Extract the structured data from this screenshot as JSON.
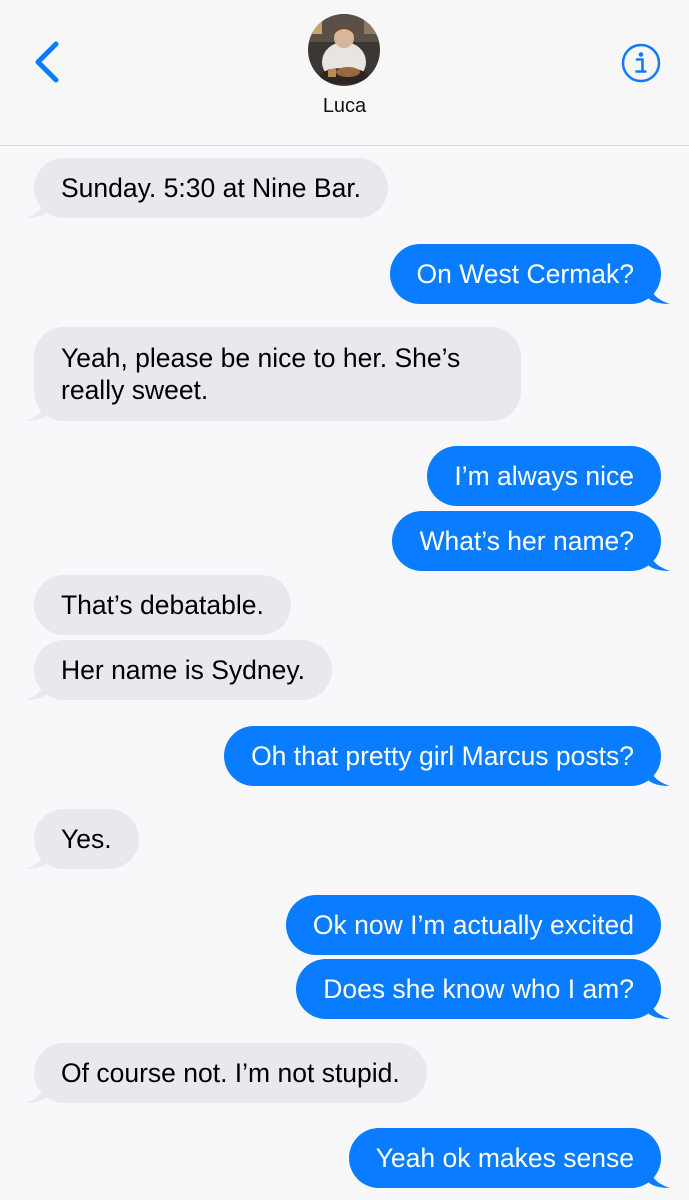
{
  "header": {
    "contact_name": "Luca",
    "back_icon": "chevron-left-icon",
    "info_icon": "info-circle-icon",
    "accent_color": "#0a7cff"
  },
  "messages": [
    {
      "direction": "incoming",
      "text": "Sunday. 5:30 at Nine Bar."
    },
    {
      "direction": "outgoing",
      "text": "On West Cermak?"
    },
    {
      "direction": "incoming",
      "text": "Yeah, please be nice to her. She’s really sweet."
    },
    {
      "direction": "outgoing",
      "text": "I’m always nice"
    },
    {
      "direction": "outgoing",
      "text": "What’s her name?"
    },
    {
      "direction": "incoming",
      "text": "That’s debatable."
    },
    {
      "direction": "incoming",
      "text": "Her name is Sydney."
    },
    {
      "direction": "outgoing",
      "text": "Oh that pretty girl Marcus posts?"
    },
    {
      "direction": "incoming",
      "text": "Yes."
    },
    {
      "direction": "outgoing",
      "text": "Ok now I’m actually excited"
    },
    {
      "direction": "outgoing",
      "text": "Does she know who I am?"
    },
    {
      "direction": "incoming",
      "text": "Of course not. I’m not stupid."
    },
    {
      "direction": "outgoing",
      "text": "Yeah ok makes sense"
    }
  ],
  "colors": {
    "incoming_bubble": "#e9e8ee",
    "outgoing_bubble": "#0a7cff",
    "background": "#f8f8fa"
  }
}
